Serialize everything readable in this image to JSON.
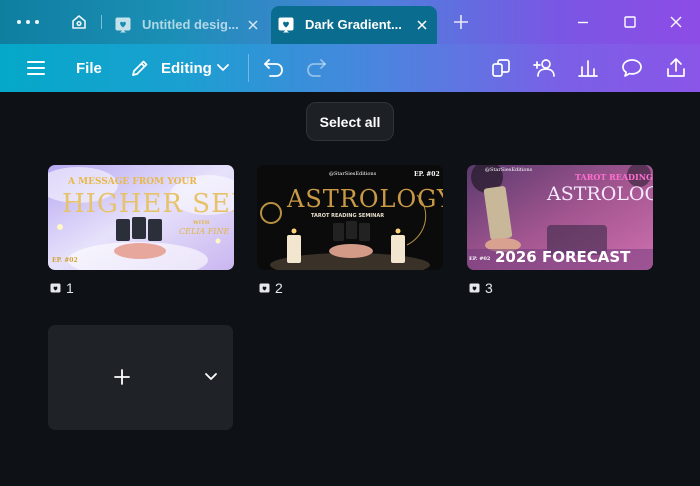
{
  "colors": {
    "accent_tab": "#0a6c8e",
    "canvas_bg": "#0e1116"
  },
  "tabs": [
    {
      "title": "Untitled desig...",
      "active": false
    },
    {
      "title": "Dark Gradient...",
      "active": true
    }
  ],
  "toolbar": {
    "file_label": "File",
    "editing_label": "Editing"
  },
  "tooltip": "Select all",
  "pages": [
    {
      "number": "1",
      "thumb": {
        "line1": "A MESSAGE FROM YOUR",
        "line2": "HIGHER SELF",
        "with": "WITH",
        "name": "CELIA FINE",
        "ep": "EP. #02"
      }
    },
    {
      "number": "2",
      "thumb": {
        "handle": "@StarSiesEditions",
        "ep": "EP. #02",
        "title": "ASTROLOGY",
        "subtitle": "TAROT READING SEMINAR"
      }
    },
    {
      "number": "3",
      "thumb": {
        "handle": "@StarSiesEditions",
        "tag": "TAROT READING",
        "title": "ASTROLOGY",
        "ep": "EP. #02",
        "forecast": "2026 FORECAST"
      }
    }
  ]
}
